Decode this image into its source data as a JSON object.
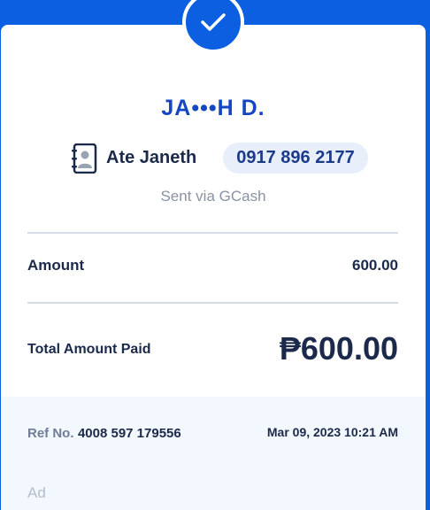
{
  "receipt": {
    "recipient_name": "JA•••H D.",
    "contact_name": "Ate Janeth",
    "phone": "0917 896 2177",
    "sent_via": "Sent via GCash",
    "amount_label": "Amount",
    "amount_value": "600.00",
    "total_label": "Total Amount Paid",
    "total_value": "₱600.00",
    "ref_label": "Ref No.",
    "ref_value": "4008 597 179556",
    "datetime": "Mar 09, 2023 10:21 AM",
    "ad_label": "Ad"
  },
  "icons": {
    "success": "checkmark-icon",
    "contact": "contact-book-icon"
  },
  "colors": {
    "brand_blue": "#0b5fe0",
    "name_blue": "#1546c4",
    "text_dark": "#1b2a4a",
    "muted": "#8a93a3"
  }
}
